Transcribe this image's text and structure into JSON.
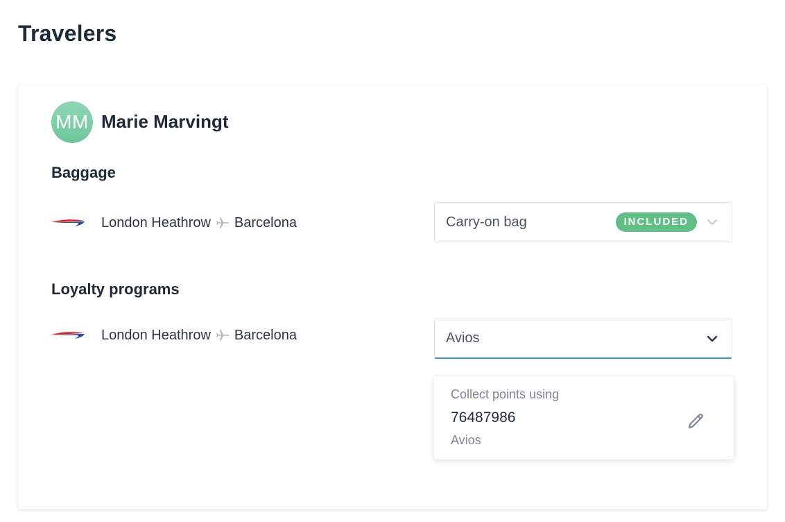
{
  "page": {
    "title": "Travelers"
  },
  "traveler": {
    "initials": "MM",
    "name": "Marie Marvingt",
    "avatar_color": "#7fcfa8"
  },
  "baggage": {
    "section_title": "Baggage",
    "route": {
      "origin": "London Heathrow",
      "destination": "Barcelona",
      "airline_logo_icon": "airline-speedmarque-logo",
      "separator_icon": "plane-icon"
    },
    "select": {
      "label": "Carry-on bag",
      "badge": "INCLUDED",
      "badge_color": "#5fbf84",
      "icon": "chevron-down-icon"
    }
  },
  "loyalty": {
    "section_title": "Loyalty programs",
    "route": {
      "origin": "London Heathrow",
      "destination": "Barcelona",
      "airline_logo_icon": "airline-speedmarque-logo",
      "separator_icon": "plane-icon"
    },
    "select": {
      "label": "Avios",
      "icon": "chevron-down-icon",
      "focus_color": "#3b8fd6"
    },
    "popover": {
      "label": "Collect points using",
      "number": "76487986",
      "program": "Avios",
      "edit_icon": "pencil-icon"
    }
  }
}
